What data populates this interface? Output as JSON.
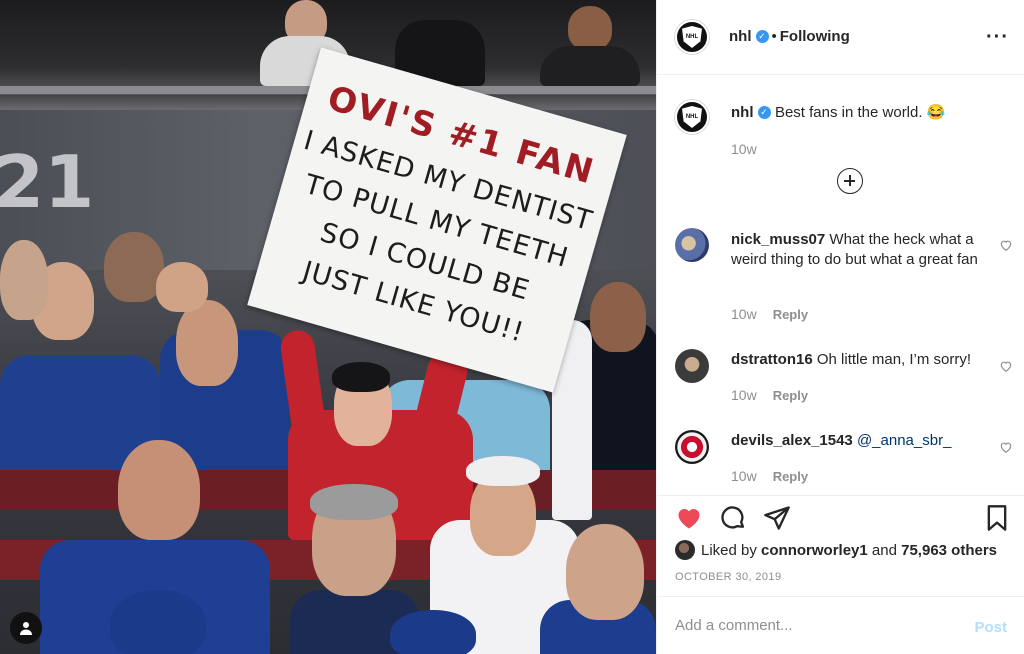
{
  "photo": {
    "sign": {
      "title": "OVI'S #1 FAN",
      "lines": [
        "I ASKED MY DENTIST",
        "TO PULL MY TEETH",
        "SO I COULD BE",
        "JUST LIKE YOU!!"
      ]
    },
    "banner_text": "21"
  },
  "header": {
    "username": "nhl",
    "separator": "•",
    "follow_label": "Following",
    "more_icon": "more-horizontal-icon"
  },
  "caption": {
    "username": "nhl",
    "text": "Best fans in the world. 😂",
    "time": "10w"
  },
  "comments": [
    {
      "username": "nick_muss07",
      "text": "What the heck what a weird thing to do but what a great fan",
      "time": "10w",
      "reply_label": "Reply"
    },
    {
      "username": "dstratton16",
      "text": "Oh little man, I’m sorry!",
      "time": "10w",
      "reply_label": "Reply"
    },
    {
      "username": "devils_alex_1543",
      "text": "@_anna_sbr_",
      "time": "10w",
      "reply_label": "Reply"
    }
  ],
  "actions": {
    "liked_by_prefix": "Liked by",
    "liked_by_user": "connorworley1",
    "and": "and",
    "others": "75,963 others",
    "date": "OCTOBER 30, 2019"
  },
  "add_comment": {
    "placeholder": "Add a comment...",
    "post_label": "Post"
  },
  "colors": {
    "like_red": "#ed4956",
    "verified_blue": "#3897f0",
    "post_disabled": "#b2dffc",
    "mention": "#00376b"
  }
}
